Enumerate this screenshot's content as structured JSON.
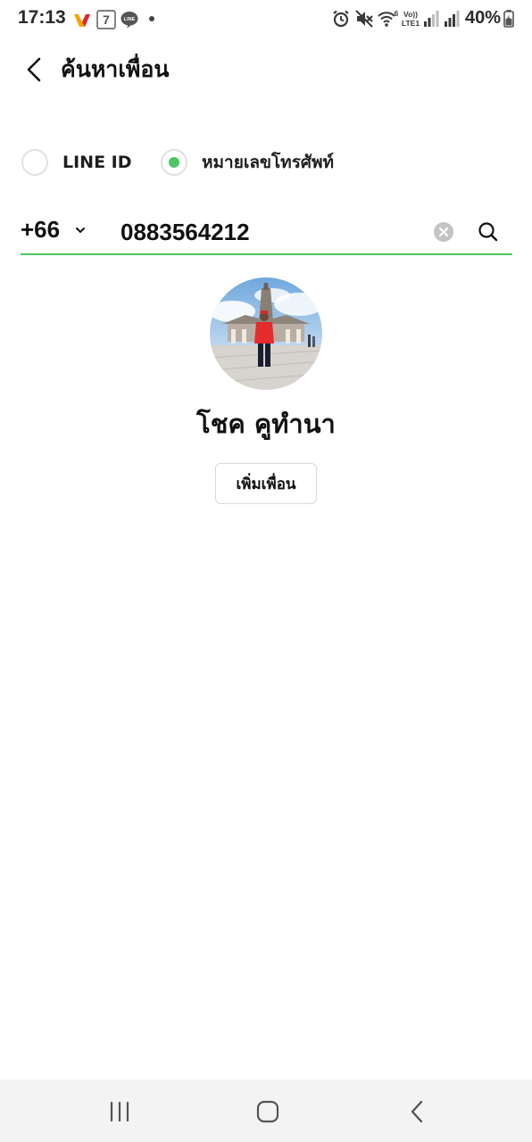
{
  "status_bar": {
    "time": "17:13",
    "battery": "40%",
    "app_icons": [
      "wongnai-icon",
      "7-eleven-icon",
      "line-chat-icon"
    ],
    "right_icons": [
      "alarm-icon",
      "mute-icon",
      "wifi-icon",
      "volte-lte1-icon",
      "signal-icon",
      "signal-2-icon",
      "battery-icon"
    ],
    "volte_label": "Vo))",
    "lte_label": "LTE1",
    "wifi_label": "6"
  },
  "header": {
    "title": "ค้นหาเพื่อน"
  },
  "search_type": {
    "options": [
      {
        "label": "LINE ID",
        "selected": false
      },
      {
        "label": "หมายเลขโทรศัพท์",
        "selected": true
      }
    ]
  },
  "search": {
    "country_code": "+66",
    "phone_value": "0883564212"
  },
  "result": {
    "name": "โชค คูทำนา",
    "add_button_label": "เพิ่มเพื่อน"
  },
  "colors": {
    "accent_green": "#4cc764",
    "border_gray": "#d9d9d9",
    "nav_bar_bg": "#f3f3f3"
  }
}
